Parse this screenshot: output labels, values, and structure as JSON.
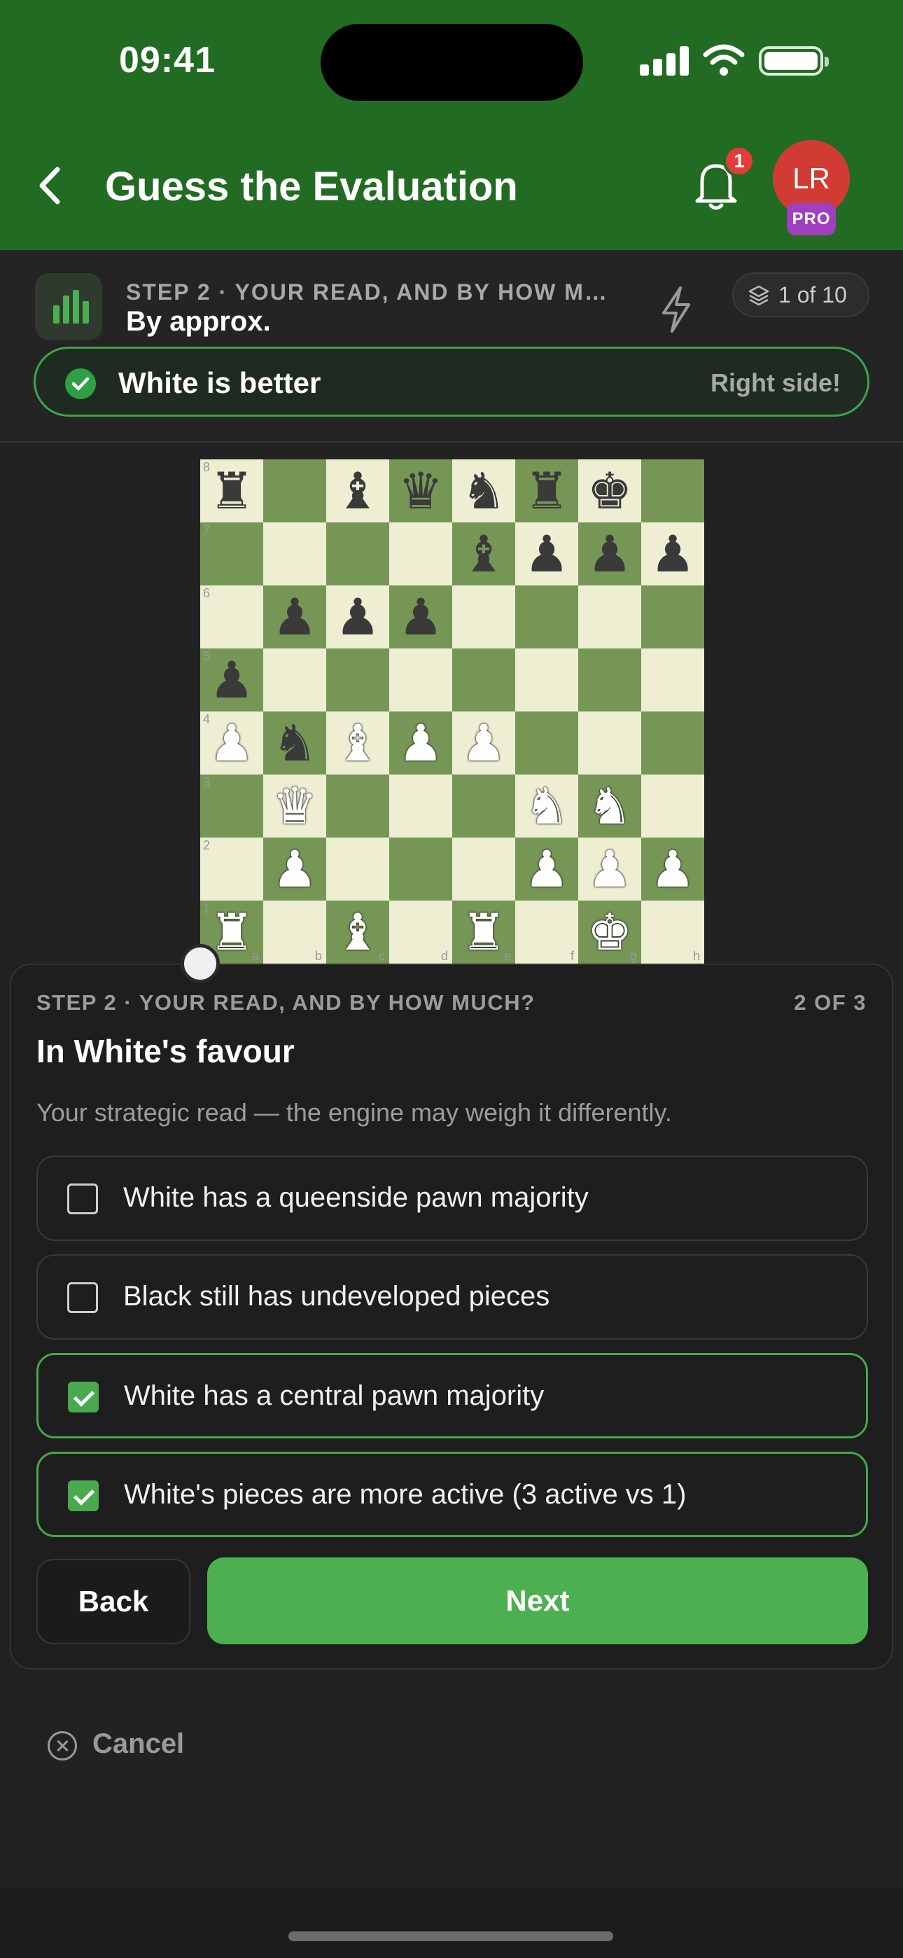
{
  "status_bar": {
    "time": "09:41"
  },
  "header": {
    "title": "Guess the Evaluation",
    "notification_count": "1",
    "avatar_initials": "LR",
    "pro_label": "PRO"
  },
  "step": {
    "kicker": "STEP 2 · YOUR READ, AND BY HOW M…",
    "subtitle": "By approx.",
    "counter": "1 of 10",
    "verdict": "White is better",
    "verdict_feedback": "Right side!"
  },
  "board": {
    "orientation": "white",
    "ranks": [
      "8",
      "7",
      "6",
      "5",
      "4",
      "3",
      "2",
      "1"
    ],
    "files": [
      "a",
      "b",
      "c",
      "d",
      "e",
      "f",
      "g",
      "h"
    ],
    "rows": [
      [
        "r",
        "",
        "b",
        "q",
        "n",
        "r",
        "k",
        ""
      ],
      [
        "",
        "",
        "",
        "",
        "b",
        "p",
        "p",
        "p"
      ],
      [
        "",
        "p",
        "p",
        "p",
        "",
        "",
        "",
        ""
      ],
      [
        "p",
        "",
        "",
        "",
        "",
        "",
        "",
        ""
      ],
      [
        "P",
        "n",
        "B",
        "P",
        "P",
        "",
        "",
        ""
      ],
      [
        "",
        "Q",
        "",
        "",
        "",
        "N",
        "N",
        ""
      ],
      [
        "",
        "P",
        "",
        "",
        "",
        "P",
        "P",
        "P"
      ],
      [
        "R",
        "",
        "B",
        "",
        "R",
        "",
        "K",
        ""
      ]
    ]
  },
  "sheet": {
    "kicker": "STEP 2 · YOUR READ, AND BY HOW MUCH?",
    "count": "2 OF 3",
    "title": "In White's favour",
    "description": "Your strategic read — the engine may weigh it differently.",
    "options": [
      {
        "label": "White has a queenside pawn majority",
        "checked": false
      },
      {
        "label": "Black still has undeveloped pieces",
        "checked": false
      },
      {
        "label": "White has a central pawn majority",
        "checked": true
      },
      {
        "label": "White's pieces are more active (3 active vs 1)",
        "checked": true
      }
    ],
    "back_label": "Back",
    "next_label": "Next"
  },
  "footer": {
    "cancel_label": "Cancel"
  },
  "colors": {
    "header_green": "#226b22",
    "accent_green": "#4caf50",
    "board_light": "#eeeed2",
    "board_dark": "#769656",
    "badge_red": "#e63b3b",
    "pro_purple": "#a03fc0"
  }
}
